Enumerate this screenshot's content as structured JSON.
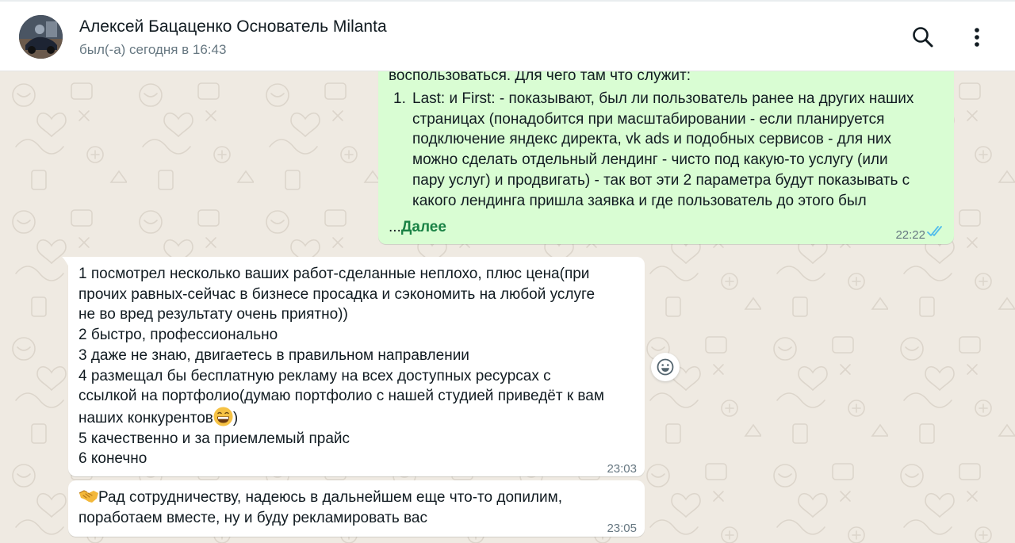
{
  "header": {
    "contact_name": "Алексей Бацаценко Основатель Milanta",
    "status": "был(-а) сегодня в 16:43",
    "icons": [
      "search-icon",
      "more-vertical-icon"
    ]
  },
  "outgoing": {
    "clipped_line": "воспользоваться. Для чего там что служит:",
    "list": [
      {
        "number": "1.",
        "lines": [
          "Last: и First: - показывают, был ли пользователь ранее на других наших",
          "страницах (понадобится при масштабировании - если планируется",
          "подключение яндекс директа, vk ads и подобных сервисов - для них",
          "можно сделать отдельный лендинг - чисто под какую-то услугу (или",
          "пару услуг) и продвигать) - так вот эти 2 параметра будут показывать с",
          "какого лендинга пришла заявка и где пользователь до этого был"
        ]
      }
    ],
    "read_more_dots": "...",
    "read_more": "Далее",
    "time": "22:22",
    "status_icon": "double-check-read-icon"
  },
  "incoming_1": {
    "lines": [
      "1 посмотрел несколько ваших работ-сделанные неплохо, плюс цена(при",
      "прочих равных-сейчас в бизнесе просадка и сэкономить на любой услуге",
      "не во вред результату очень приятно))",
      "2 быстро, профессионально",
      "3 даже не знаю, двигаетесь в правильном направлении",
      "4 размещал бы бесплатную рекламу на всех доступных ресурсах с",
      "ссылкой на портфолио(думаю портфолио с нашей студией приведёт к вам",
      "наших конкурентов",
      "5 качественно и за приемлемый прайс",
      "6 конечно"
    ],
    "line8_suffix": ")",
    "emoji": "grinning-face-emoji",
    "time": "23:03"
  },
  "incoming_2": {
    "lines": [
      "Рад сотрудничеству, надеюсь в дальнейшем еще что-то допилим,",
      "поработаем вместе, ну и буду рекламировать вас"
    ],
    "emoji": "handshake-emoji",
    "time": "23:05"
  },
  "reaction_button_icon": "smiley-reaction-icon",
  "colors": {
    "outgoing_bubble": "#d9fdd3",
    "incoming_bubble": "#ffffff",
    "chat_background": "#efeae2",
    "read_more_link": "#1a8245",
    "read_ticks": "#53bdeb"
  }
}
